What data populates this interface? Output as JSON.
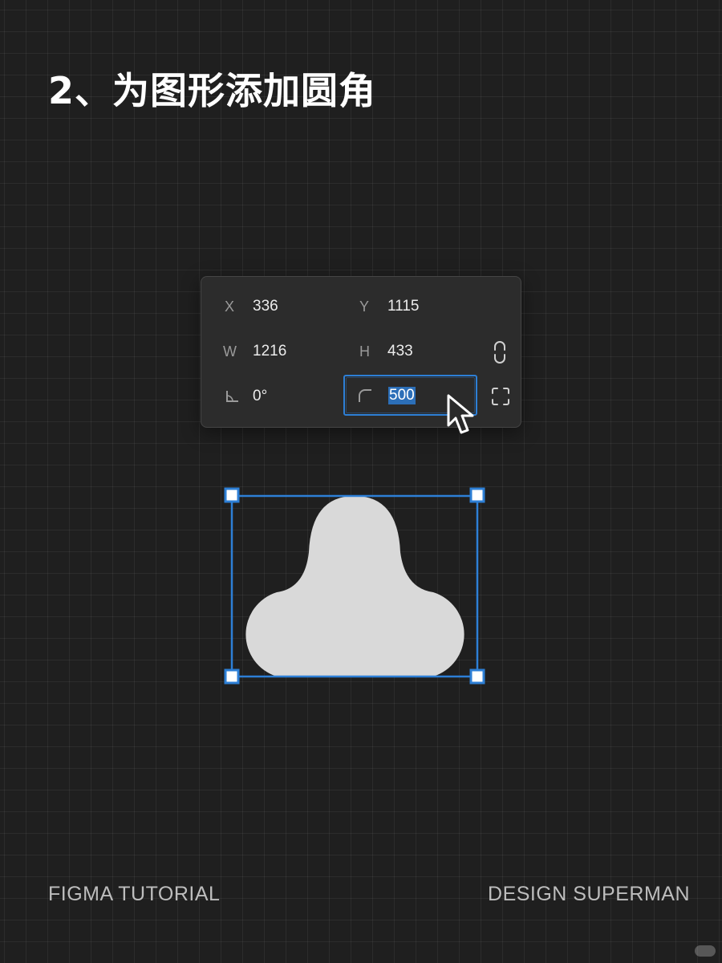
{
  "title": "2、为图形添加圆角",
  "properties_panel": {
    "x": {
      "label": "X",
      "value": "336"
    },
    "y": {
      "label": "Y",
      "value": "1115"
    },
    "w": {
      "label": "W",
      "value": "1216"
    },
    "h": {
      "label": "H",
      "value": "433"
    },
    "rotation": {
      "icon": "rotation-angle-icon",
      "value": "0°"
    },
    "corner_radius": {
      "icon": "corner-radius-icon",
      "value": "500"
    },
    "constrain_proportions_icon": "link-icon",
    "independent_corners_icon": "independent-corners-icon"
  },
  "canvas": {
    "shape": "rounded-shape",
    "selection_color": "#2d7fd6",
    "shape_fill": "#d9d9d9"
  },
  "footer": {
    "left": "FIGMA TUTORIAL",
    "right": "DESIGN SUPERMAN"
  }
}
